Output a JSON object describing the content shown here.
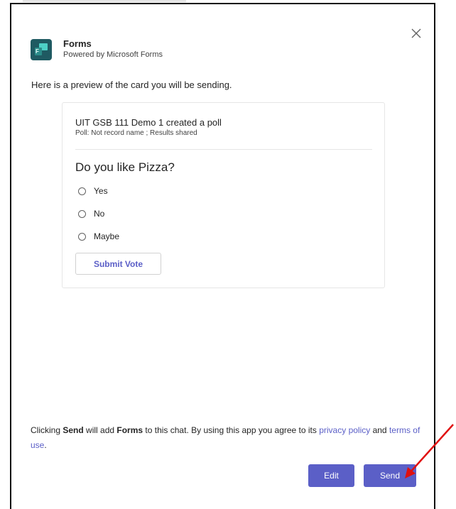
{
  "app": {
    "name": "Forms",
    "subtitle": "Powered by Microsoft Forms"
  },
  "preview_text": "Here is a preview of the card you will be sending.",
  "card": {
    "title": "UIT GSB 111 Demo 1 created a poll",
    "meta": "Poll: Not record name ; Results shared",
    "question": "Do you like Pizza?",
    "options": [
      "Yes",
      "No",
      "Maybe"
    ],
    "submit_label": "Submit Vote"
  },
  "footer": {
    "part1": "Clicking ",
    "send_word": "Send",
    "part2": " will add ",
    "forms_word": "Forms",
    "part3": " to this chat. By using this app you agree to its ",
    "privacy_link": "privacy policy",
    "part4": " and ",
    "terms_link": "terms of use",
    "part5": "."
  },
  "buttons": {
    "edit": "Edit",
    "send": "Send"
  },
  "colors": {
    "accent": "#5b5fc7",
    "annotation_arrow": "#e01010"
  }
}
